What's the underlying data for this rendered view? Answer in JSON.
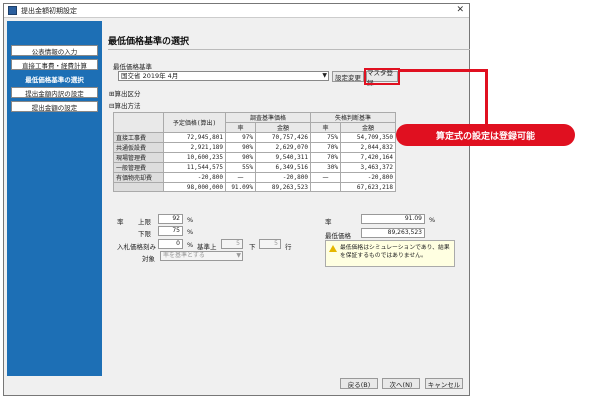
{
  "window": {
    "title": "提出金額初期設定"
  },
  "sidebar": {
    "items": [
      {
        "label": "公表情報の入力"
      },
      {
        "label": "直接工事費・経費計算"
      },
      {
        "label": "最低価格基準の選択"
      },
      {
        "label": "提出金額内訳の設定"
      },
      {
        "label": "提出金額の設定"
      }
    ]
  },
  "main": {
    "title": "最低価格基準の選択",
    "criterion_label": "最低価格基準",
    "criterion_value": "国交省 2019年 4月",
    "settings_change_button": "設定変更",
    "master_register_button": "マスタ登録",
    "tree_calc_category": "算出区分",
    "tree_calc_method": "算出方法"
  },
  "table": {
    "headers": {
      "planned": "予定価格(算出)",
      "survey": "調査基準価格",
      "loss": "失格判断基準",
      "rate": "率",
      "amount": "金額"
    },
    "rows": [
      {
        "name": "直接工事費",
        "planned": "72,945,801",
        "s_rate": "97%",
        "s_amount": "70,757,426",
        "l_rate": "75%",
        "l_amount": "54,709,350"
      },
      {
        "name": "共通仮設費",
        "planned": "2,921,189",
        "s_rate": "90%",
        "s_amount": "2,629,070",
        "l_rate": "70%",
        "l_amount": "2,044,832"
      },
      {
        "name": "現場管理費",
        "planned": "10,600,235",
        "s_rate": "90%",
        "s_amount": "9,540,311",
        "l_rate": "70%",
        "l_amount": "7,420,164"
      },
      {
        "name": "一般管理費",
        "planned": "11,544,575",
        "s_rate": "55%",
        "s_amount": "6,349,516",
        "l_rate": "30%",
        "l_amount": "3,463,372"
      },
      {
        "name": "有価物売却費",
        "planned": "-20,800",
        "s_rate": "一",
        "s_amount": "-20,800",
        "l_rate": "一",
        "l_amount": "-20,800"
      }
    ],
    "total": {
      "planned": "98,000,000",
      "s_rate": "91.09%",
      "s_amount": "89,263,523",
      "l_amount": "67,623,218"
    }
  },
  "form": {
    "rate_label": "率",
    "upper_label": "上限",
    "upper_value": "92",
    "lower_label": "下限",
    "lower_value": "75",
    "percent": "%",
    "bid_label": "入札価格刻み",
    "bid_value": "0",
    "base_label": "基準上",
    "base_up": "5",
    "down_label": "下",
    "base_down": "5",
    "row_unit": "行",
    "target_label": "対象",
    "target_value": "率を基準とする",
    "result_rate_label": "率",
    "result_rate_value": "91.09",
    "min_price_label": "最低価格",
    "min_price_value": "89,263,523"
  },
  "warning": {
    "text": "最低価格はシミュレーションであり、結果を保証するものではありません。"
  },
  "footer": {
    "back": "戻る(B)",
    "next": "次へ(N)",
    "cancel": "キャンセル"
  },
  "callout": {
    "text": "算定式の設定は登録可能"
  },
  "colors": {
    "sidebar": "#1d6fb5",
    "accent_red": "#e01020"
  }
}
